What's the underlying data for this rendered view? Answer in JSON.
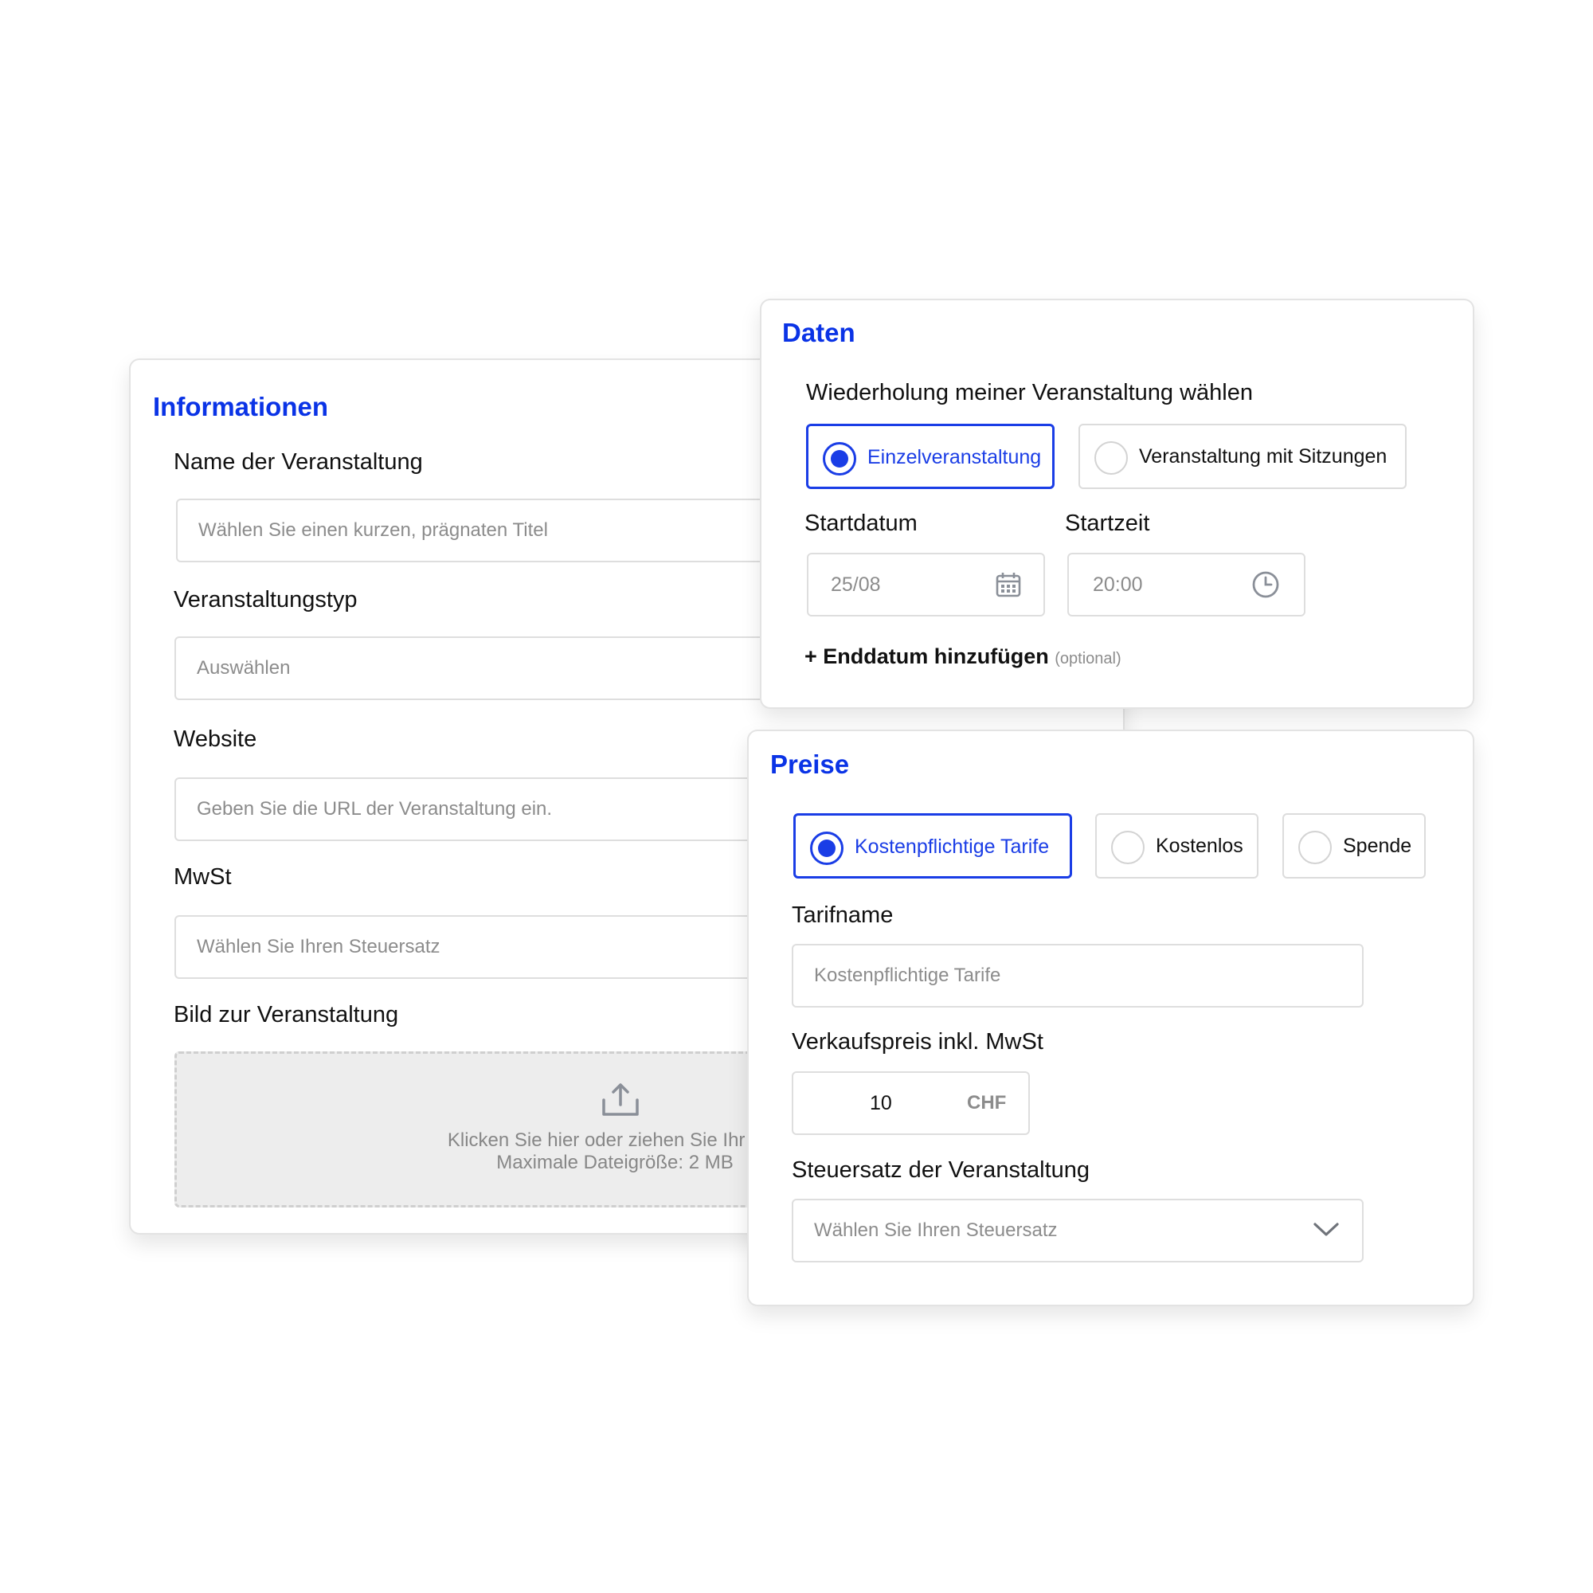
{
  "info": {
    "title": "Informationen",
    "name_label": "Name der Veranstaltung",
    "name_placeholder": "Wählen Sie einen kurzen, prägnaten Titel",
    "type_label": "Veranstaltungstyp",
    "type_placeholder": "Auswählen",
    "website_label": "Website",
    "website_placeholder": "Geben Sie die URL der Veranstaltung ein.",
    "vat_label": "MwSt",
    "vat_placeholder": "Wählen Sie Ihren Steuersatz",
    "image_label": "Bild zur Veranstaltung",
    "upload_line1": "Klicken Sie hier oder ziehen Sie Ihr Bild",
    "upload_line2": "Maximale Dateigröße: 2 MB",
    "upload_icon": "upload-icon"
  },
  "daten": {
    "title": "Daten",
    "repeat_label": "Wiederholung meiner Veranstaltung wählen",
    "options": [
      {
        "label": "Einzelveranstaltung",
        "selected": true
      },
      {
        "label": "Veranstaltung mit Sitzungen",
        "selected": false
      }
    ],
    "start_date_label": "Startdatum",
    "start_date_value": "25/08",
    "start_time_label": "Startzeit",
    "start_time_value": "20:00",
    "add_end_date": "+ Enddatum hinzufügen",
    "optional": "(optional)",
    "calendar_icon": "calendar-icon",
    "clock_icon": "clock-icon"
  },
  "preise": {
    "title": "Preise",
    "options": [
      {
        "label": "Kostenpflichtige Tarife",
        "selected": true
      },
      {
        "label": "Kostenlos",
        "selected": false
      },
      {
        "label": "Spende",
        "selected": false
      }
    ],
    "tariff_label": "Tarifname",
    "tariff_placeholder": "Kostenpflichtige Tarife",
    "price_label": "Verkaufspreis inkl. MwSt",
    "price_value": "10",
    "currency": "CHF",
    "tax_label": "Steuersatz der Veranstaltung",
    "tax_placeholder": "Wählen Sie Ihren Steuersatz",
    "dropdown_icon": "chevron-down-icon"
  },
  "colors": {
    "accent": "#1a3de6",
    "title": "#0a33e6",
    "border": "#dedede",
    "upload_bg": "#ededed"
  }
}
